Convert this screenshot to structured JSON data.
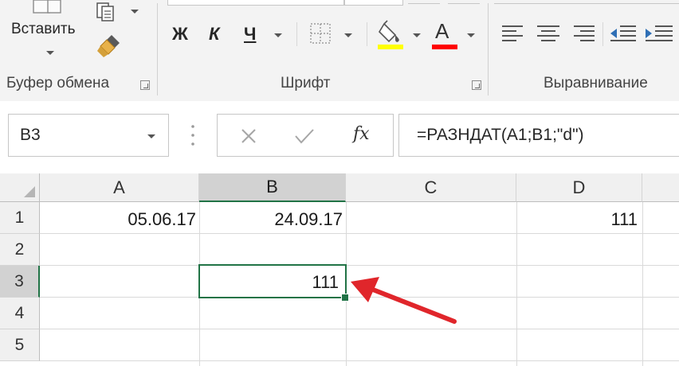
{
  "ribbon": {
    "clipboard": {
      "paste_label": "Вставить",
      "group_label": "Буфер обмена"
    },
    "font": {
      "bold_label": "Ж",
      "italic_label": "К",
      "underline_label": "Ч",
      "font_color_label": "А",
      "group_label": "Шрифт",
      "fill_color": "#ffff00",
      "font_color": "#ff0000"
    },
    "alignment": {
      "group_label": "Выравнивание"
    }
  },
  "formula_bar": {
    "name_box": "B3",
    "fx_label": "fx",
    "formula": "=РАЗНДАТ(A1;B1;\"d\")"
  },
  "sheet": {
    "columns": [
      "A",
      "B",
      "C",
      "D"
    ],
    "rows": [
      "1",
      "2",
      "3",
      "4",
      "5"
    ],
    "selected_cell": "B3",
    "cells": {
      "A1": "05.06.17",
      "B1": "24.09.17",
      "D1": "111",
      "B3": "111"
    }
  },
  "colors": {
    "selection": "#217346",
    "arrow": "#e0262b"
  }
}
